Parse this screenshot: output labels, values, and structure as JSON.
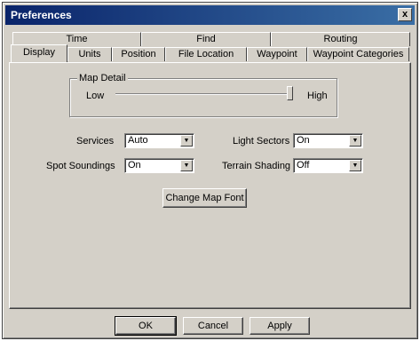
{
  "window": {
    "title": "Preferences",
    "close_glyph": "x"
  },
  "tabs": {
    "row_back": [
      "Time",
      "Find",
      "Routing"
    ],
    "row_front": [
      "Display",
      "Units",
      "Position",
      "File Location",
      "Waypoint",
      "Waypoint Categories"
    ],
    "active": "Display"
  },
  "map_detail": {
    "group_label": "Map Detail",
    "low_label": "Low",
    "high_label": "High",
    "slider_fraction": 1.0
  },
  "fields": {
    "services": {
      "label": "Services",
      "value": "Auto"
    },
    "light_sectors": {
      "label": "Light Sectors",
      "value": "On"
    },
    "spot_soundings": {
      "label": "Spot Soundings",
      "value": "On"
    },
    "terrain_shading": {
      "label": "Terrain Shading",
      "value": "Off"
    }
  },
  "buttons": {
    "change_map_font": "Change Map Font",
    "ok": "OK",
    "cancel": "Cancel",
    "apply": "Apply"
  },
  "icons": {
    "close": "close-icon",
    "dropdown": "chevron-down-icon"
  }
}
